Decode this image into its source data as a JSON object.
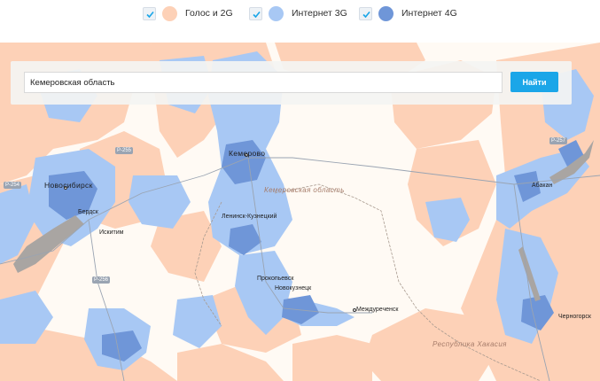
{
  "legend": {
    "items": [
      {
        "label": "Голос и 2G",
        "color": "#fdd1b7",
        "checked": true
      },
      {
        "label": "Интернет 3G",
        "color": "#a8c8f4",
        "checked": true
      },
      {
        "label": "Интернет 4G",
        "color": "#6f96d8",
        "checked": true
      }
    ]
  },
  "search": {
    "value": "Кемеровская область",
    "button_label": "Найти"
  },
  "map": {
    "cities": [
      "Новосибирск",
      "Бердск",
      "Искитим",
      "Кемерово",
      "Прокопьевск",
      "Ленинск-Кузнецкий",
      "Новокузнецк",
      "Междуреченск",
      "Черногорск",
      "Абакан"
    ],
    "regions": [
      "Кемеровская область",
      "Республика Хакасия"
    ],
    "roads": [
      "Р-255",
      "Р-254",
      "Р-256",
      "Р-257"
    ]
  }
}
